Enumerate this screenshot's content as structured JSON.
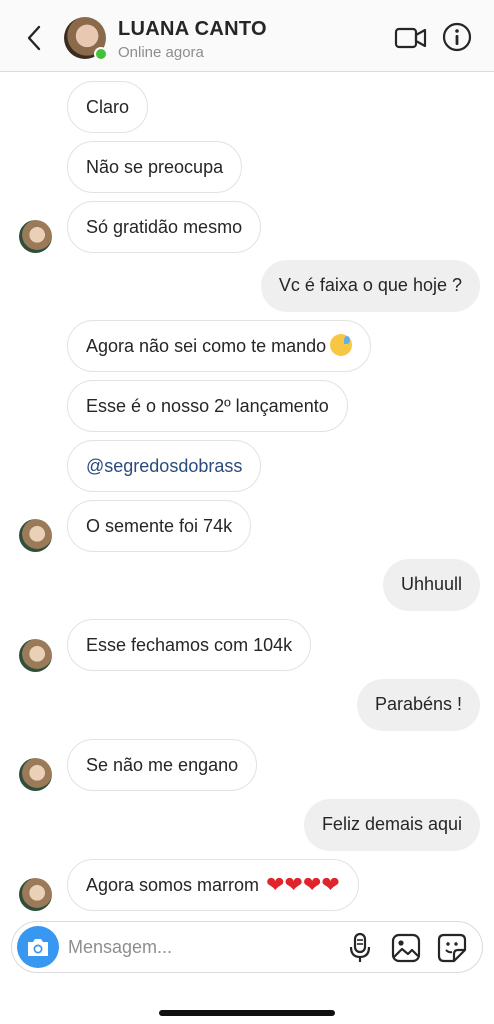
{
  "header": {
    "contact_name": "LUANA CANTO",
    "status": "Online agora",
    "back_icon": "chevron-left-icon",
    "video_icon": "video-camera-icon",
    "info_icon": "info-icon"
  },
  "messages": [
    {
      "dir": "in",
      "text": "Claro"
    },
    {
      "dir": "in",
      "text": "Não se preocupa"
    },
    {
      "dir": "in",
      "text": "Só gratidão mesmo"
    },
    {
      "dir": "out",
      "text": "Vc é faixa o que hoje ?"
    },
    {
      "dir": "in",
      "text": "Agora não sei como te mando",
      "emoji": "sad-sweat-face"
    },
    {
      "dir": "in",
      "text": "Esse é o nosso 2º lançamento"
    },
    {
      "dir": "in",
      "text": "@segredosdobrass"
    },
    {
      "dir": "in",
      "text": "O semente foi 74k"
    },
    {
      "dir": "out",
      "text": "Uhhuull"
    },
    {
      "dir": "in",
      "text": "Esse fechamos com 104k"
    },
    {
      "dir": "out",
      "text": "Parabéns !"
    },
    {
      "dir": "in",
      "text": "Se não me engano"
    },
    {
      "dir": "out",
      "text": "Feliz demais aqui"
    },
    {
      "dir": "in",
      "text": "Agora somos marrom",
      "hearts": "❤❤❤❤"
    }
  ],
  "composer": {
    "placeholder": "Mensagem...",
    "camera_icon": "camera-icon",
    "mic_icon": "microphone-icon",
    "gallery_icon": "image-icon",
    "sticker_icon": "sticker-icon"
  },
  "colors": {
    "accent": "#3897f0",
    "online": "#43c13b",
    "link": "#2a4b7c",
    "heart": "#e0242b"
  }
}
